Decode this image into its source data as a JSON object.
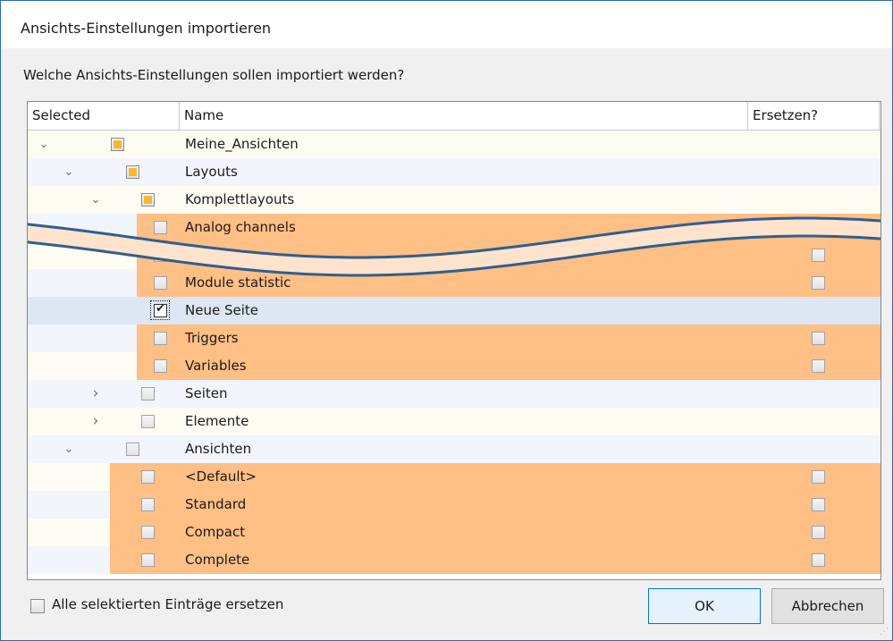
{
  "dialog": {
    "title": "Ansichts-Einstellungen importieren",
    "question": "Welche Ansichts-Einstellungen sollen importiert werden?"
  },
  "columns": {
    "selected": "Selected",
    "name": "Name",
    "replace": "Ersetzen?"
  },
  "rows": [
    {
      "label": "Meine_Ansichten",
      "level": 0,
      "expander": "expanded",
      "state": "partial"
    },
    {
      "label": "Layouts",
      "level": 1,
      "expander": "expanded",
      "state": "partial"
    },
    {
      "label": "Komplettlayouts",
      "level": 2,
      "expander": "expanded",
      "state": "partial"
    },
    {
      "label": "Analog channels",
      "level": 3,
      "expander": "none",
      "state": "unchecked",
      "highlighted": true,
      "replace_box": true
    },
    {
      "label": "",
      "level": 3,
      "expander": "none",
      "state": "unchecked",
      "highlighted": true,
      "replace_box": true
    },
    {
      "label": "Module statistic",
      "level": 3,
      "expander": "none",
      "state": "unchecked",
      "highlighted": true,
      "replace_box": true
    },
    {
      "label": "Neue Seite",
      "level": 3,
      "expander": "none",
      "state": "checked",
      "selected": true,
      "replace_box": false
    },
    {
      "label": "Triggers",
      "level": 3,
      "expander": "none",
      "state": "unchecked",
      "highlighted": true,
      "replace_box": true
    },
    {
      "label": "Variables",
      "level": 3,
      "expander": "none",
      "state": "unchecked",
      "highlighted": true,
      "replace_box": true
    },
    {
      "label": "Seiten",
      "level": 2,
      "expander": "collapsed",
      "state": "unchecked"
    },
    {
      "label": "Elemente",
      "level": 2,
      "expander": "collapsed",
      "state": "unchecked"
    },
    {
      "label": "Ansichten",
      "level": 1,
      "expander": "expanded",
      "state": "unchecked"
    },
    {
      "label": "<Default>",
      "level": 2,
      "expander": "none",
      "state": "unchecked",
      "highlighted": true,
      "replace_box": true
    },
    {
      "label": "Standard",
      "level": 2,
      "expander": "none",
      "state": "unchecked",
      "highlighted": true,
      "replace_box": true
    },
    {
      "label": "Compact",
      "level": 2,
      "expander": "none",
      "state": "unchecked",
      "highlighted": true,
      "replace_box": true
    },
    {
      "label": "Complete",
      "level": 2,
      "expander": "none",
      "state": "unchecked",
      "highlighted": true,
      "replace_box": true
    }
  ],
  "footer": {
    "replace_all_label": "Alle selektierten Einträge ersetzen",
    "ok_label": "OK",
    "cancel_label": "Abbrechen"
  },
  "colors": {
    "highlight": "#ffbf85",
    "partial_fill": "#f7b733",
    "row_odd": "#fefcf3",
    "row_even": "#f2f5fb",
    "row_selected": "#dde7f4",
    "break_line": "#2f5f8f"
  },
  "icons": {
    "expanded": "chevron-down-icon",
    "collapsed": "chevron-right-icon"
  }
}
